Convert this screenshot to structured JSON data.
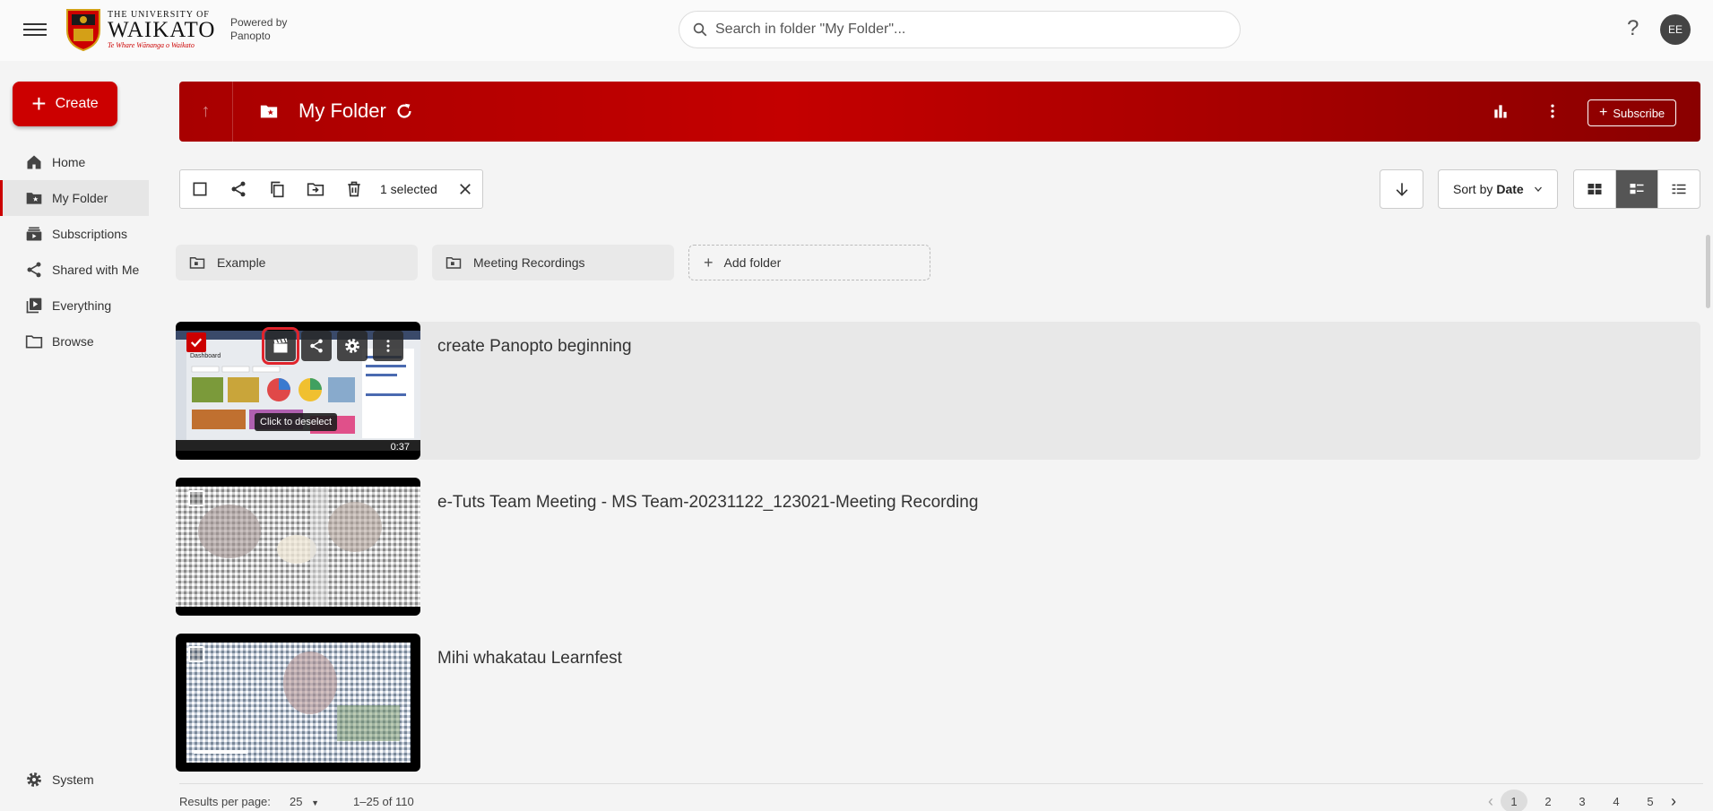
{
  "header": {
    "logo_line1": "THE UNIVERSITY OF",
    "logo_line2": "WAIKATO",
    "logo_tagline": "Te Whare Wānanga o Waikato",
    "powered_by": "Powered by",
    "powered_name": "Panopto",
    "search_placeholder": "Search in folder \"My Folder\"...",
    "help": "?",
    "avatar_initials": "EE"
  },
  "sidebar": {
    "create_label": "Create",
    "items": [
      {
        "label": "Home",
        "icon": "home-icon"
      },
      {
        "label": "My Folder",
        "icon": "star-folder-icon",
        "active": true
      },
      {
        "label": "Subscriptions",
        "icon": "subscriptions-icon"
      },
      {
        "label": "Shared with Me",
        "icon": "share-icon"
      },
      {
        "label": "Everything",
        "icon": "video-library-icon"
      },
      {
        "label": "Browse",
        "icon": "folder-icon"
      }
    ],
    "system_label": "System"
  },
  "banner": {
    "title": "My Folder",
    "subscribe_label": "Subscribe",
    "color": "#c00000"
  },
  "toolbar": {
    "selected_count": "1 selected",
    "sort_prefix": "Sort by",
    "sort_value": "Date"
  },
  "folders": [
    {
      "label": "Example"
    },
    {
      "label": "Meeting Recordings"
    },
    {
      "label": "Add folder"
    }
  ],
  "sessions": [
    {
      "title": "create Panopto beginning",
      "duration": "0:37",
      "selected": true,
      "tooltip": "Click to deselect"
    },
    {
      "title": "e-Tuts Team Meeting - MS Team-20231122_123021-Meeting Recording",
      "selected": false
    },
    {
      "title": "Mihi whakatau Learnfest",
      "selected": false
    }
  ],
  "footer": {
    "results_per_page_label": "Results per page:",
    "results_per_page_value": "25",
    "range": "1–25 of 110",
    "pages": [
      "1",
      "2",
      "3",
      "4",
      "5"
    ],
    "current_page": "1"
  },
  "colors": {
    "accent": "#cc0000",
    "highlight_box": "#e0242c"
  }
}
